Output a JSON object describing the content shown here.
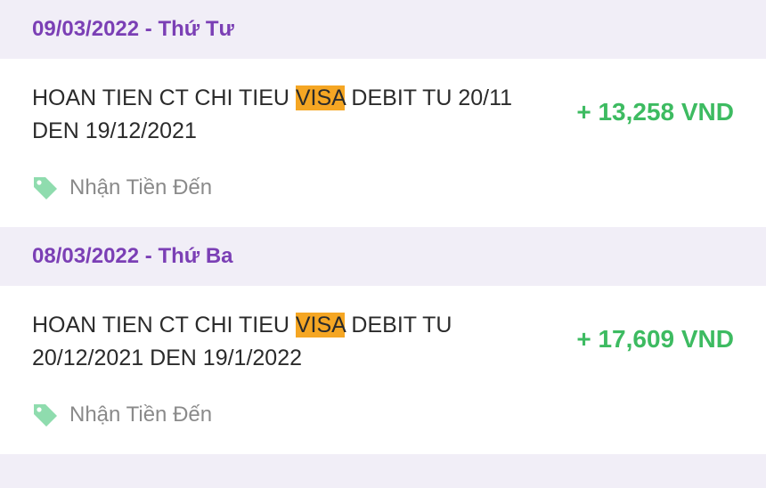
{
  "groups": [
    {
      "date_label": "09/03/2022 - Thứ Tư",
      "transaction": {
        "desc_before": "HOAN TIEN CT CHI TIEU ",
        "desc_highlight": "VISA",
        "desc_line1_after": " DEBIT TU 20/11",
        "desc_line2": "DEN 19/12/2021",
        "amount": "+ 13,258 VND",
        "category": "Nhận Tiền Đến",
        "category_icon": "tag-icon"
      }
    },
    {
      "date_label": "08/03/2022 - Thứ Ba",
      "transaction": {
        "desc_before": "HOAN TIEN CT CHI TIEU ",
        "desc_highlight": "VISA",
        "desc_line1_after": " DEBIT TU",
        "desc_line2": "20/12/2021 DEN 19/1/2022",
        "amount": "+ 17,609 VND",
        "category": "Nhận Tiền Đến",
        "category_icon": "tag-icon"
      }
    }
  ],
  "colors": {
    "header_text": "#7b3fb5",
    "amount_positive": "#3dbb61",
    "highlight": "#f5a623",
    "tag_icon": "#8fdcae"
  }
}
